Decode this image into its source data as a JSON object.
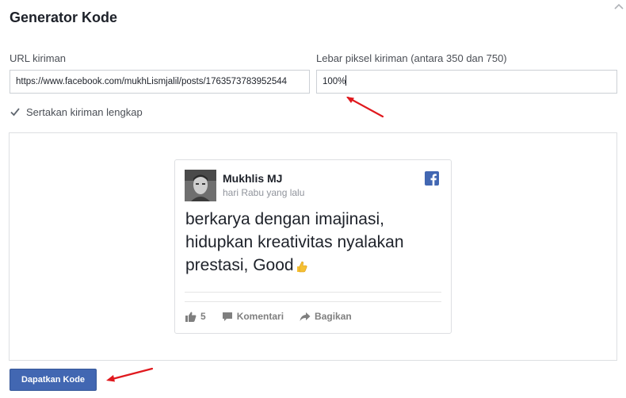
{
  "page": {
    "title": "Generator Kode"
  },
  "form": {
    "url_label": "URL kiriman",
    "url_value": "https://www.facebook.com/mukhLismjalil/posts/1763573783952544",
    "width_label": "Lebar piksel kiriman (antara 350 dan 750)",
    "width_value": "100%",
    "include_full_post_label": "Sertakan kiriman lengkap",
    "include_full_post_checked": true
  },
  "preview_post": {
    "author": "Mukhlis MJ",
    "timestamp": "hari Rabu yang lalu",
    "message": "berkarya dengan imajinasi, hidupkan kreativitas nyalakan prestasi, Good",
    "message_emoji": "thumbs-up-emoji",
    "like_count": "5",
    "comment_label": "Komentari",
    "share_label": "Bagikan"
  },
  "submit": {
    "label": "Dapatkan Kode"
  },
  "colors": {
    "accent": "#4267b2",
    "annotation_arrow": "#e0191e",
    "facebook_icon": "#4267b2"
  }
}
